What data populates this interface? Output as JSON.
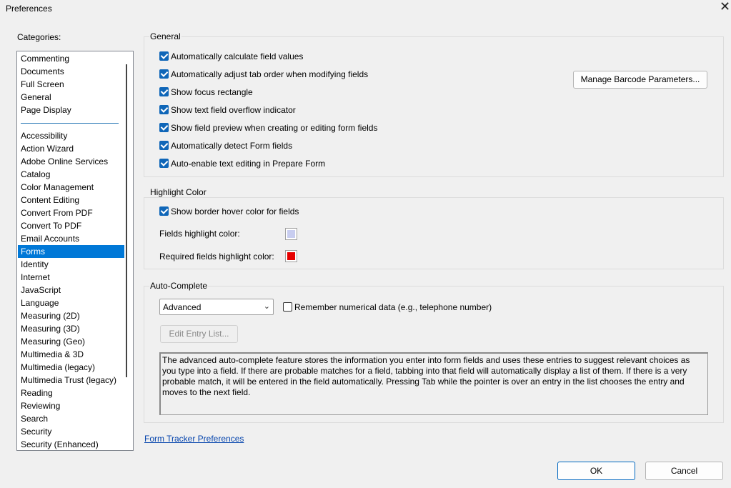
{
  "window": {
    "title": "Preferences",
    "close_glyph": "✕"
  },
  "categories": {
    "label": "Categories:",
    "top_items": [
      "Commenting",
      "Documents",
      "Full Screen",
      "General",
      "Page Display"
    ],
    "items": [
      "Accessibility",
      "Action Wizard",
      "Adobe Online Services",
      "Catalog",
      "Color Management",
      "Content Editing",
      "Convert From PDF",
      "Convert To PDF",
      "Email Accounts",
      "Forms",
      "Identity",
      "Internet",
      "JavaScript",
      "Language",
      "Measuring (2D)",
      "Measuring (3D)",
      "Measuring (Geo)",
      "Multimedia & 3D",
      "Multimedia (legacy)",
      "Multimedia Trust (legacy)",
      "Reading",
      "Reviewing",
      "Search",
      "Security",
      "Security (Enhanced)"
    ],
    "selected": "Forms"
  },
  "general": {
    "title": "General",
    "options": [
      {
        "label": "Automatically calculate field values",
        "checked": true
      },
      {
        "label": "Automatically adjust tab order when modifying fields",
        "checked": true
      },
      {
        "label": "Show focus rectangle",
        "checked": true
      },
      {
        "label": "Show text field overflow indicator",
        "checked": true
      },
      {
        "label": "Show field preview when creating or editing form fields",
        "checked": true
      },
      {
        "label": "Automatically detect Form fields",
        "checked": true
      },
      {
        "label": "Auto-enable text editing in Prepare Form",
        "checked": true
      }
    ],
    "barcode_button": "Manage Barcode Parameters..."
  },
  "highlight": {
    "title": "Highlight Color",
    "border_hover": {
      "label": "Show border hover color for fields",
      "checked": true
    },
    "fields_label": "Fields highlight color:",
    "fields_color": "#c8cdf0",
    "required_label": "Required fields highlight color:",
    "required_color": "#e60000"
  },
  "autocomplete": {
    "title": "Auto-Complete",
    "mode": "Advanced",
    "remember": {
      "label": "Remember numerical data (e.g., telephone number)",
      "checked": false
    },
    "edit_button": "Edit Entry List...",
    "description": "The advanced auto-complete feature stores the information you enter into form fields and uses these entries to suggest relevant choices as you type into a field. If there are probable matches for a field, tabbing into that field will automatically display a list of them. If there is a very probable match, it will be entered in the field automatically. Pressing Tab while the pointer is over an entry in the list chooses the entry and moves to the next field."
  },
  "form_tracker_link": "Form Tracker Preferences",
  "buttons": {
    "ok": "OK",
    "cancel": "Cancel"
  },
  "colors": {
    "accent": "#0078d7",
    "checkbox": "#0f66b8",
    "link": "#0645ad"
  }
}
